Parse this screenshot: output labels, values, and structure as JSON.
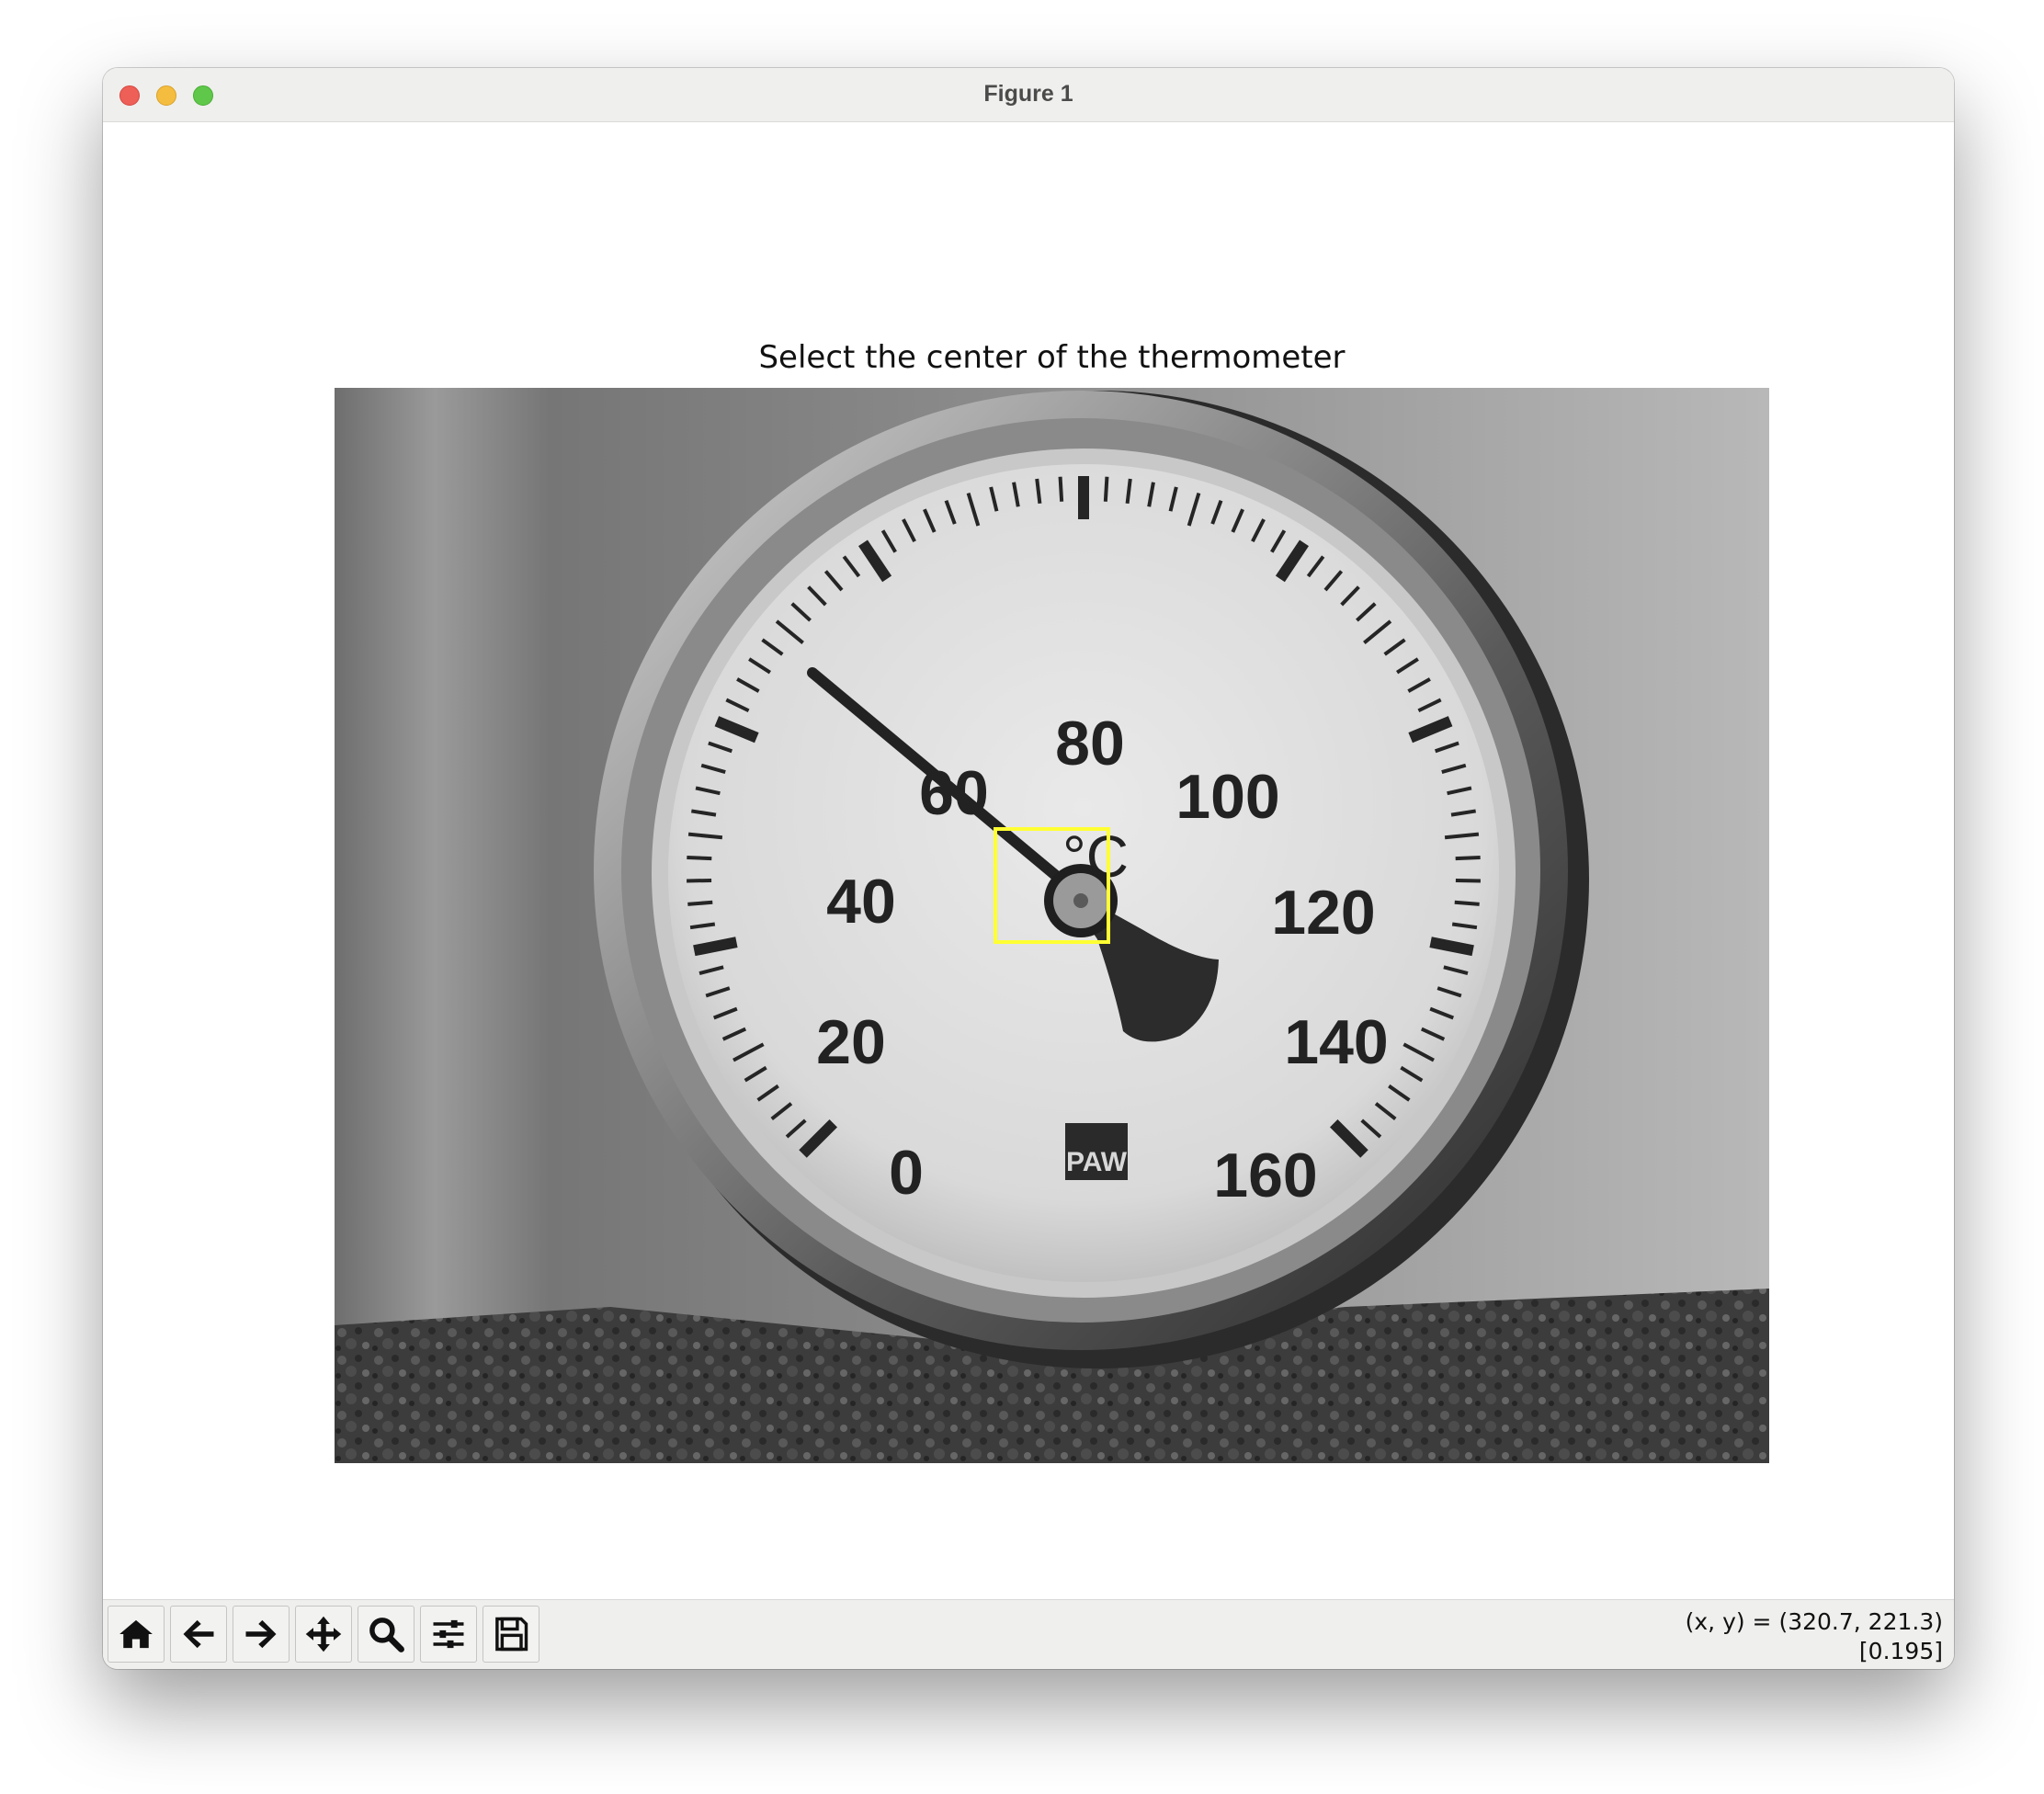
{
  "window": {
    "title": "Figure 1",
    "controls": [
      "close",
      "minimize",
      "maximize"
    ]
  },
  "figure": {
    "axes_title": "Select the center of the thermometer",
    "image_description": "grayscale photo of a round dial thermometer",
    "image_labels": {
      "dial_numbers": [
        "0",
        "20",
        "40",
        "60",
        "80",
        "100",
        "120",
        "140",
        "160"
      ],
      "unit": "°C",
      "logo": "PAW"
    },
    "selection_box_color": "#ffff33"
  },
  "toolbar": {
    "buttons": [
      {
        "name": "home",
        "icon": "home-icon"
      },
      {
        "name": "back",
        "icon": "arrow-left-icon"
      },
      {
        "name": "forward",
        "icon": "arrow-right-icon"
      },
      {
        "name": "pan",
        "icon": "move-icon"
      },
      {
        "name": "zoom",
        "icon": "magnifier-icon"
      },
      {
        "name": "configure-subplots",
        "icon": "sliders-icon"
      },
      {
        "name": "save",
        "icon": "floppy-disk-icon"
      }
    ],
    "status_coords": "(x, y) = (320.7, 221.3)",
    "status_value": "[0.195]"
  }
}
